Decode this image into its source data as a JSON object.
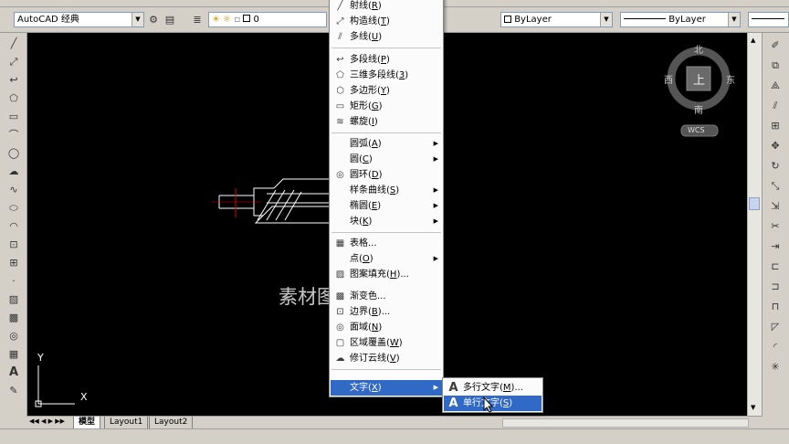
{
  "toolbar": {
    "workspace": "AutoCAD 经典",
    "layer_value": "0",
    "color": "ByLayer",
    "linetype": "ByLayer"
  },
  "compass": {
    "north": "北",
    "south": "南",
    "east": "东",
    "west": "西",
    "top": "上",
    "wcs": "WCS"
  },
  "watermark": "素材图",
  "draw_menu": {
    "items": [
      {
        "label": "射线",
        "key": "R"
      },
      {
        "label": "构造线",
        "key": "T"
      },
      {
        "label": "多线",
        "key": "U"
      },
      {
        "label": "多段线",
        "key": "P"
      },
      {
        "label": "三维多段线",
        "key": "3"
      },
      {
        "label": "多边形",
        "key": "Y"
      },
      {
        "label": "矩形",
        "key": "G"
      },
      {
        "label": "螺旋",
        "key": "I"
      },
      {
        "label": "圆弧",
        "key": "A"
      },
      {
        "label": "圆",
        "key": "C"
      },
      {
        "label": "圆环",
        "key": "D"
      },
      {
        "label": "样条曲线",
        "key": "S"
      },
      {
        "label": "椭圆",
        "key": "E"
      },
      {
        "label": "块",
        "key": "K"
      },
      {
        "label": "表格...",
        "key": ""
      },
      {
        "label": "点",
        "key": "O"
      },
      {
        "label": "图案填充",
        "key": "H",
        "suffix": "..."
      },
      {
        "label": "渐变色...",
        "key": ""
      },
      {
        "label": "边界",
        "key": "B",
        "suffix": "..."
      },
      {
        "label": "面域",
        "key": "N"
      },
      {
        "label": "区域覆盖",
        "key": "W"
      },
      {
        "label": "修订云线",
        "key": "V"
      },
      {
        "label": "文字",
        "key": "X"
      }
    ]
  },
  "text_submenu": {
    "items": [
      {
        "label": "多行文字",
        "key": "M",
        "suffix": "..."
      },
      {
        "label": "单行文字",
        "key": "S"
      }
    ]
  },
  "tabs": [
    "模型",
    "Layout1",
    "Layout2"
  ],
  "ucs": {
    "x": "X",
    "y": "Y"
  },
  "icons": {
    "left": [
      "line-icon",
      "construction-line-icon",
      "polyline-icon",
      "polygon-icon",
      "rectangle-icon",
      "arc-icon",
      "circle-icon",
      "revcloud-icon",
      "spline-icon",
      "ellipse-icon",
      "ellipse-arc-icon",
      "insert-block-icon",
      "make-block-icon",
      "point-icon",
      "hatch-icon",
      "gradient-icon",
      "region-icon",
      "table-icon",
      "text-icon",
      "add-selected-icon"
    ],
    "right": [
      "erase-icon",
      "copy-icon",
      "mirror-icon",
      "offset-icon",
      "array-icon",
      "move-icon",
      "rotate-icon",
      "scale-icon",
      "stretch-icon",
      "trim-icon",
      "extend-icon",
      "break-at-point-icon",
      "break-icon",
      "join-icon",
      "chamfer-icon",
      "fillet-icon",
      "explode-icon"
    ]
  }
}
